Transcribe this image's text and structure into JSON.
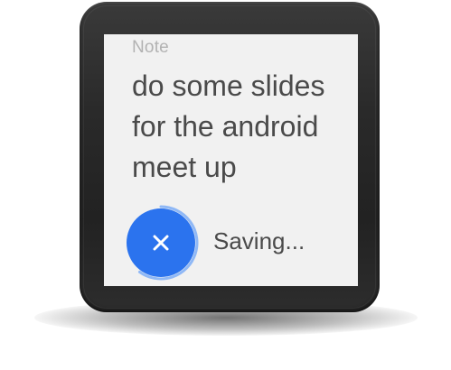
{
  "note": {
    "label": "Note",
    "text": "do some slides\nfor the android\nmeet up"
  },
  "action": {
    "cancel_icon": "close-icon",
    "status": "Saving...",
    "progress": 0.6
  },
  "colors": {
    "screen_background": "#f1f1f1",
    "accent_blue": "#2b73ee",
    "progress_ring": "#8fb8f6",
    "label_gray": "#b2b2b2",
    "text_dark": "#4a4a4a",
    "watch_body": "#2a2a2a"
  }
}
